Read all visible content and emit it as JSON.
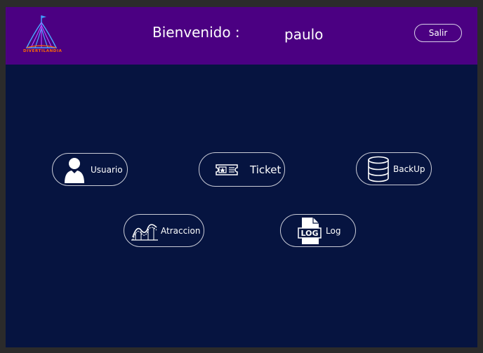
{
  "header": {
    "logo_text": "DIVERTILANDIA",
    "welcome_label": "Bienvenido :",
    "username": "paulo",
    "logout_label": "Salir"
  },
  "menu": {
    "usuario": {
      "label": "Usuario",
      "icon": "user-icon"
    },
    "ticket": {
      "label": "Ticket",
      "icon": "ticket-icon"
    },
    "backup": {
      "label": "BackUp",
      "icon": "database-icon"
    },
    "atraccion": {
      "label": "Atraccion",
      "icon": "roller-coaster-icon"
    },
    "log": {
      "label": "Log",
      "icon": "log-file-icon"
    }
  },
  "colors": {
    "header_bg": "#4b0082",
    "body_bg": "#061440",
    "button_border": "#c9cbd6",
    "logo_accent": "#ff6a00"
  }
}
